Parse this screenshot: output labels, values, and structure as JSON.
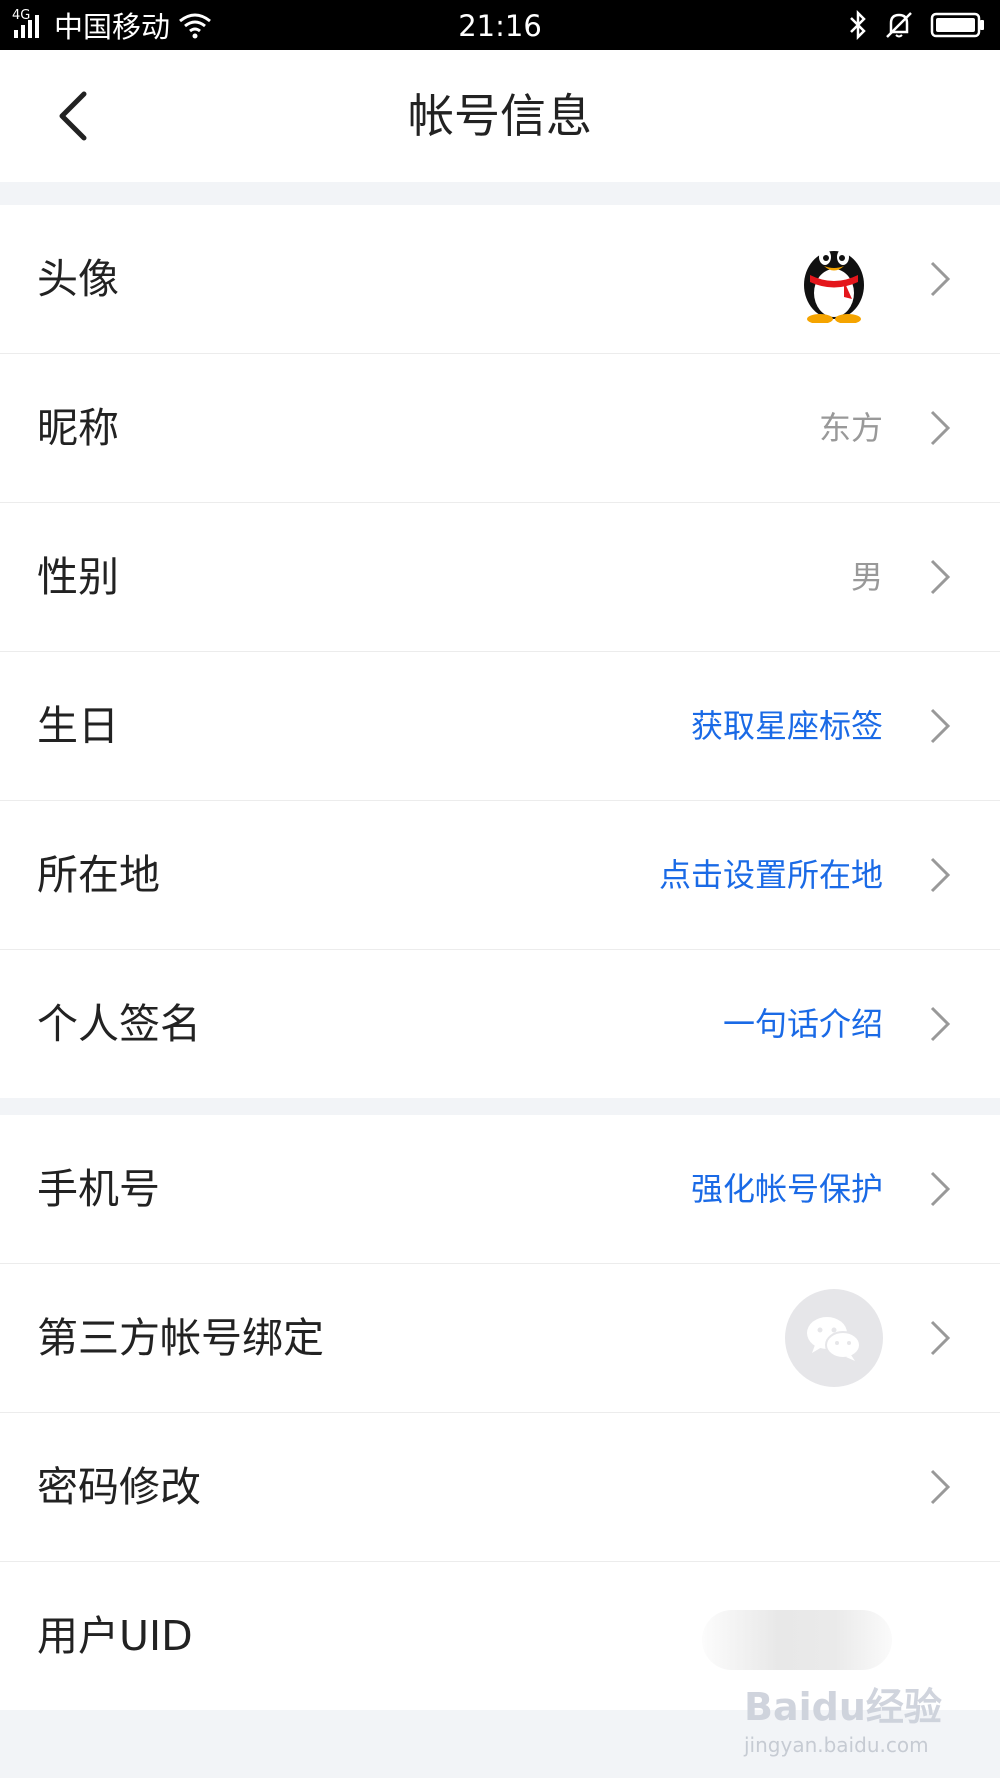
{
  "status_bar": {
    "network": "4G",
    "carrier": "中国移动",
    "time": "21:16",
    "icons": [
      "signal-icon",
      "wifi-icon",
      "bluetooth-icon",
      "mute-bell-icon",
      "battery-icon"
    ]
  },
  "header": {
    "title": "帐号信息",
    "back_icon": "chevron-left-icon"
  },
  "groups": [
    {
      "rows": [
        {
          "label": "头像",
          "value": "",
          "value_type": "avatar",
          "avatar_icon": "qq-penguin-icon"
        },
        {
          "label": "昵称",
          "value": "东方",
          "value_type": "text"
        },
        {
          "label": "性别",
          "value": "男",
          "value_type": "text"
        },
        {
          "label": "生日",
          "value": "获取星座标签",
          "value_type": "link"
        },
        {
          "label": "所在地",
          "value": "点击设置所在地",
          "value_type": "link"
        },
        {
          "label": "个人签名",
          "value": "一句话介绍",
          "value_type": "link"
        }
      ]
    },
    {
      "rows": [
        {
          "label": "手机号",
          "value": "强化帐号保护",
          "value_type": "link"
        },
        {
          "label": "第三方帐号绑定",
          "value": "",
          "value_type": "icon",
          "icon": "wechat-icon"
        },
        {
          "label": "密码修改",
          "value": "",
          "value_type": "none"
        },
        {
          "label": "用户UID",
          "value": "",
          "value_type": "blurred"
        }
      ]
    }
  ],
  "watermark": {
    "brand": "Baidu经验",
    "url": "jingyan.baidu.com"
  },
  "colors": {
    "link": "#1a6ae6",
    "value_gray": "#999999",
    "background": "#f2f4f7",
    "separator": "#ececec"
  }
}
